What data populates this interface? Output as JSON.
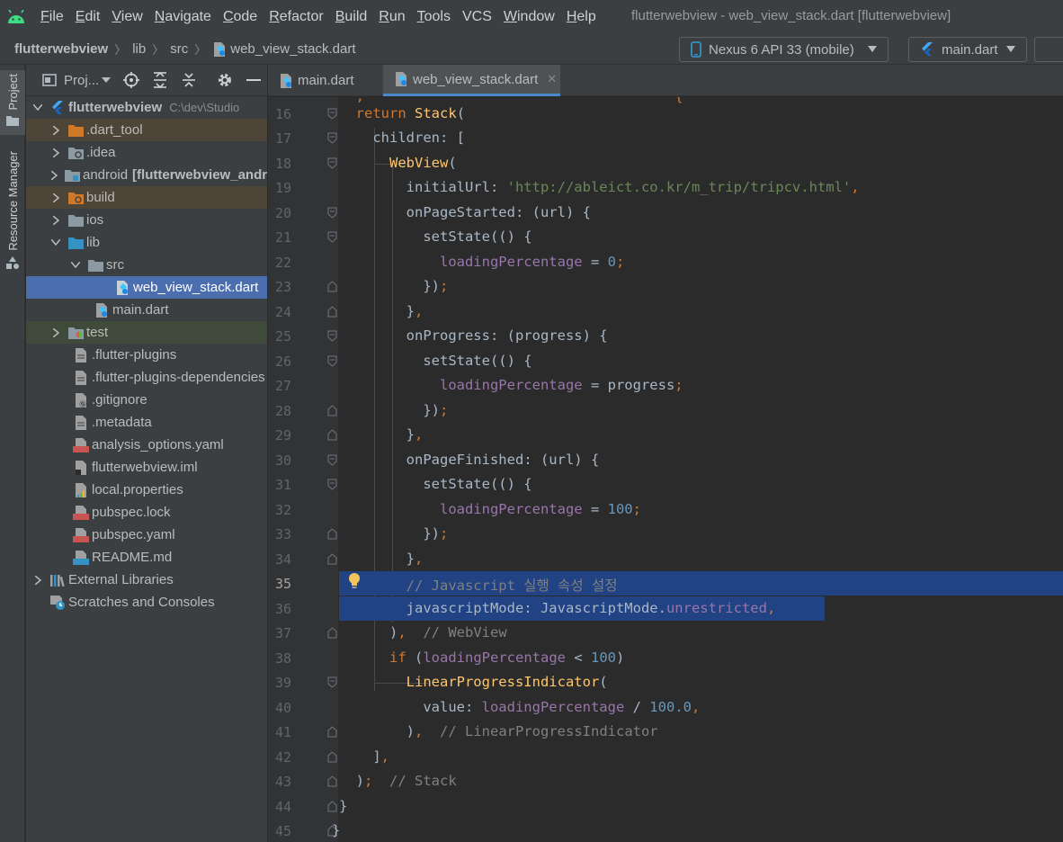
{
  "menubar": {
    "items": [
      {
        "mn": "F",
        "rest": "ile"
      },
      {
        "mn": "E",
        "rest": "dit"
      },
      {
        "mn": "V",
        "rest": "iew"
      },
      {
        "mn": "N",
        "rest": "avigate"
      },
      {
        "mn": "C",
        "rest": "ode"
      },
      {
        "mn": "R",
        "rest": "efactor"
      },
      {
        "mn": "B",
        "rest": "uild"
      },
      {
        "mn": "R",
        "rest": "un"
      },
      {
        "mn": "T",
        "rest": "ools"
      },
      {
        "mn": "VCS",
        "rest": ""
      },
      {
        "mn": "W",
        "rest": "indow"
      },
      {
        "mn": "H",
        "rest": "elp"
      }
    ],
    "window_title": "flutterwebview - web_view_stack.dart [flutterwebview]"
  },
  "navbar": {
    "crumbs": [
      "flutterwebview",
      "lib",
      "src",
      "web_view_stack.dart"
    ],
    "device": "Nexus 6 API 33 (mobile)",
    "run_config": "main.dart"
  },
  "toolstrip": {
    "project_tab": "Project",
    "resource_tab": "Resource Manager"
  },
  "project_panel": {
    "title": "Proj...",
    "root_name": "flutterwebview",
    "root_path": "C:\\dev\\Studio",
    "items": [
      ".dart_tool",
      ".idea",
      "android",
      "build",
      "ios",
      "lib",
      "src",
      "web_view_stack.dart",
      "main.dart",
      "test",
      ".flutter-plugins",
      ".flutter-plugins-dependencies",
      ".gitignore",
      ".metadata",
      "analysis_options.yaml",
      "flutterwebview.iml",
      "local.properties",
      "pubspec.lock",
      "pubspec.yaml",
      "README.md",
      "External Libraries",
      "Scratches and Consoles"
    ],
    "android_module": "[flutterwebview_android]"
  },
  "tabs": [
    "main.dart",
    "web_view_stack.dart"
  ],
  "editor": {
    "line_numbers": [
      "16",
      "17",
      "18",
      "19",
      "20",
      "21",
      "22",
      "23",
      "24",
      "25",
      "26",
      "27",
      "28",
      "29",
      "30",
      "31",
      "32",
      "33",
      "34",
      "35",
      "36",
      "37",
      "38",
      "39",
      "40",
      "41",
      "42",
      "43",
      "44",
      "45"
    ],
    "current_line": "35",
    "url": "'http://ableict.co.kr/m_trip/tripcv.html'",
    "comment_korean": "// Javascript 실행 속성 설정",
    "comment_webview": "// WebView",
    "comment_lpi": "// LinearProgressIndicator",
    "comment_stack": "// Stack"
  },
  "colors": {
    "keyword": "#cc7832",
    "type": "#ffc66d",
    "string": "#6a8759",
    "number": "#6897bb",
    "field": "#9876aa",
    "comment": "#808080",
    "selection": "#214283",
    "tree_selection": "#4b6eaf"
  }
}
